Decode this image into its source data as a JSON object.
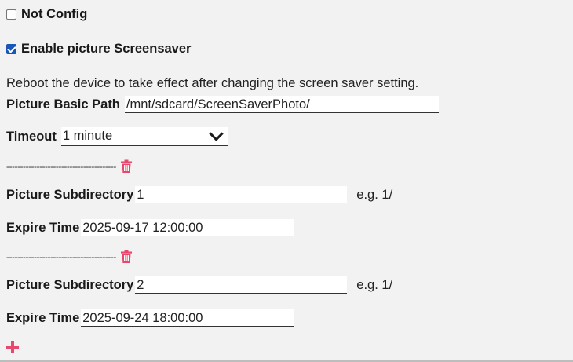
{
  "not_config": {
    "label": "Not Config",
    "checked": false
  },
  "enable_screensaver": {
    "label": "Enable picture Screensaver",
    "checked": true
  },
  "note": "Reboot the device to take effect after changing the screen saver setting.",
  "basic_path": {
    "label": "Picture Basic Path",
    "value": "/mnt/sdcard/ScreenSaverPhoto/"
  },
  "timeout": {
    "label": "Timeout",
    "value": "1 minute"
  },
  "entries": [
    {
      "separator": "----------------------------------------",
      "subdir_label": "Picture Subdirectory",
      "subdir_value": "1",
      "subdir_hint": "e.g. 1/",
      "expire_label": "Expire Time",
      "expire_value": "2025-09-17 12:00:00"
    },
    {
      "separator": "----------------------------------------",
      "subdir_label": "Picture Subdirectory",
      "subdir_value": "2",
      "subdir_hint": "e.g. 1/",
      "expire_label": "Expire Time",
      "expire_value": "2025-09-24 18:00:00"
    }
  ],
  "colors": {
    "accent_pink": "#e8476e",
    "checkbox_blue": "#1a55b8"
  },
  "icons": {
    "delete": "trash-icon",
    "add": "plus-icon"
  }
}
